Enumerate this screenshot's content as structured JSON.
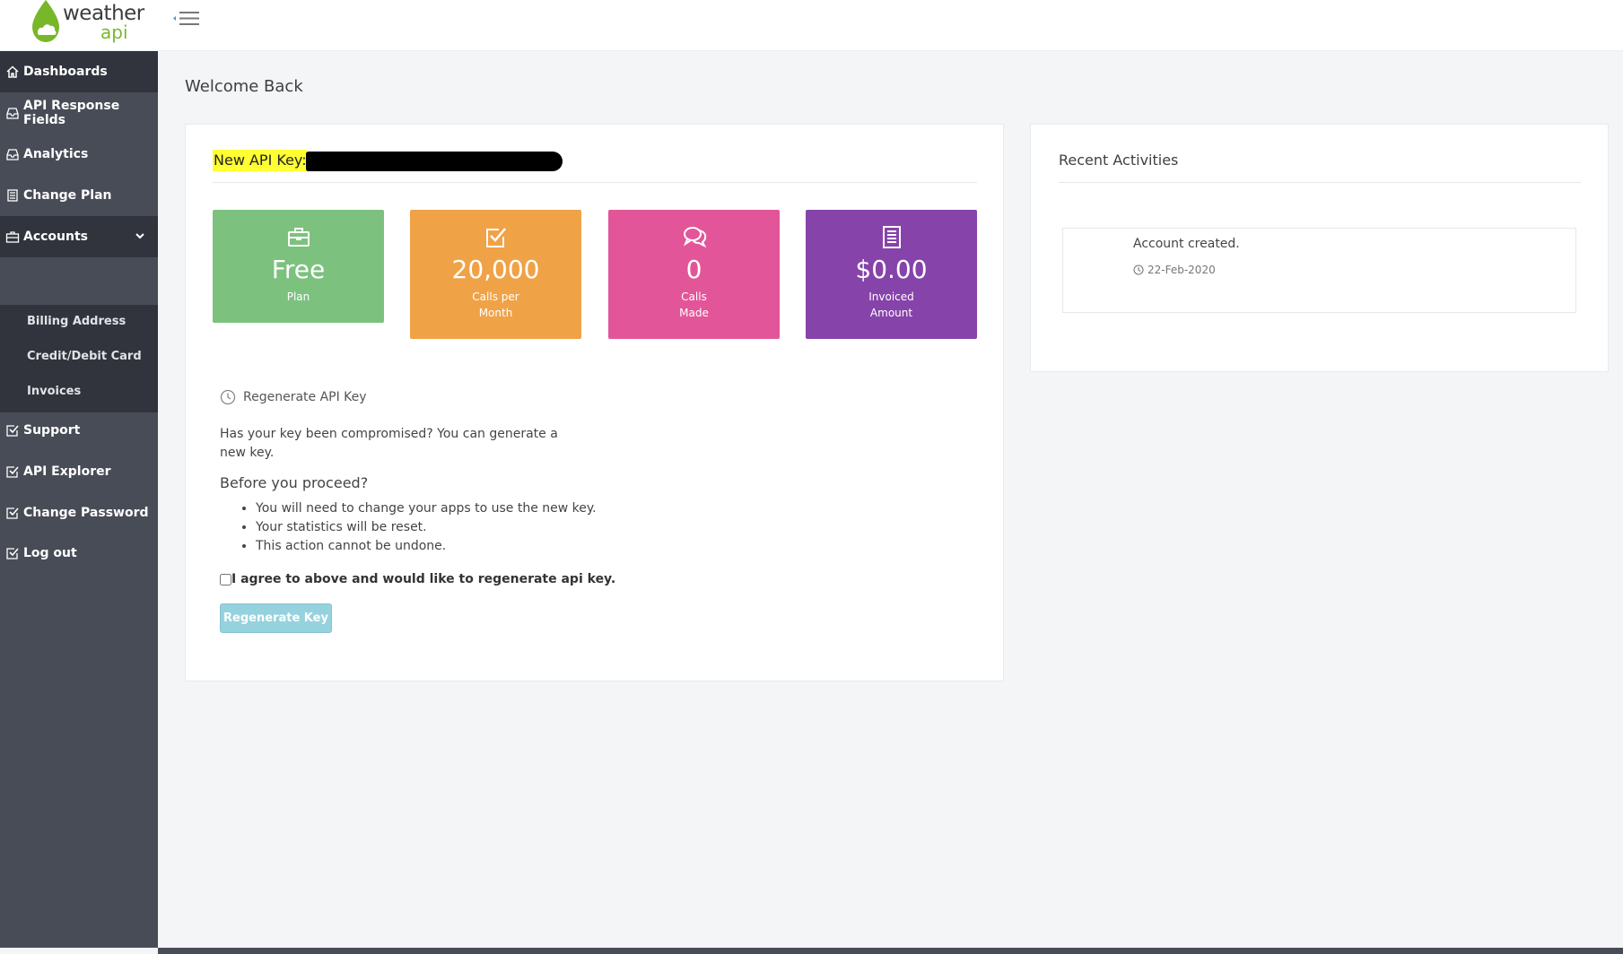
{
  "header": {
    "logo_word1": "weather",
    "logo_word2": "api",
    "menu_toggle_icon": "hamburger-collapse-icon"
  },
  "sidebar": {
    "items": [
      {
        "label": "Dashboards",
        "icon": "home-icon",
        "active": true
      },
      {
        "label": "API Response Fields",
        "icon": "inbox-icon"
      },
      {
        "label": "Analytics",
        "icon": "inbox-icon"
      },
      {
        "label": "Change Plan",
        "icon": "document-icon"
      },
      {
        "label": "Accounts",
        "icon": "briefcase-icon",
        "expanded": true
      },
      {
        "label": "Support",
        "icon": "checkbox-icon"
      },
      {
        "label": "API Explorer",
        "icon": "checkbox-icon"
      },
      {
        "label": "Change Password",
        "icon": "checkbox-icon"
      },
      {
        "label": "Log out",
        "icon": "checkbox-icon"
      }
    ],
    "accounts_sub": [
      {
        "label": "Billing Address"
      },
      {
        "label": "Credit/Debit Card"
      },
      {
        "label": "Invoices"
      }
    ]
  },
  "main": {
    "title": "Welcome Back",
    "api_key_label": "New API Key:",
    "stats": [
      {
        "value": "Free",
        "label_line1": "Plan",
        "label_line2": "",
        "icon": "briefcase-icon",
        "color": "#7dc17f"
      },
      {
        "value": "20,000",
        "label_line1": "Calls per",
        "label_line2": "Month",
        "icon": "checkbox-icon",
        "color": "#f0a247"
      },
      {
        "value": "0",
        "label_line1": "Calls",
        "label_line2": "Made",
        "icon": "chat-bubbles-icon",
        "color": "#e35599"
      },
      {
        "value": "$0.00",
        "label_line1": "Invoiced",
        "label_line2": "Amount",
        "icon": "document-icon",
        "color": "#8643a9"
      }
    ],
    "regenerate": {
      "heading": "Regenerate API Key",
      "description": "Has your key been compromised? You can generate a new key.",
      "subheading": "Before you proceed?",
      "bullets": [
        "You will need to change your apps to use the new key.",
        "Your statistics will be reset.",
        "This action cannot be undone."
      ],
      "agree_label": "I agree to above and would like to regenerate api key.",
      "button_label": "Regenerate Key"
    }
  },
  "recent": {
    "title": "Recent Activities",
    "activities": [
      {
        "text": "Account created.",
        "date": "22-Feb-2020"
      }
    ]
  },
  "colors": {
    "sidebar_bg": "#484c57",
    "sidebar_active": "#31343c",
    "highlight": "#ffff33",
    "button": "#96d2de"
  }
}
